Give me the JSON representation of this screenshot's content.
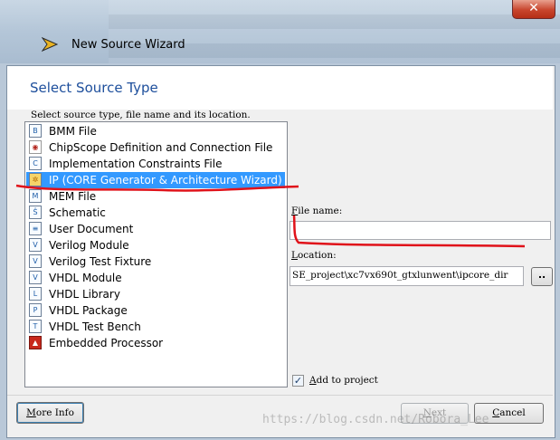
{
  "window": {
    "title": "New Source Wizard",
    "close_label": "✕"
  },
  "page": {
    "heading": "Select Source Type",
    "instruction": "Select source type, file name and its location."
  },
  "source_types": [
    {
      "label": "BMM File",
      "icon": "bmm-file-icon",
      "selected": false
    },
    {
      "label": "ChipScope Definition and Connection File",
      "icon": "chipscope-icon",
      "selected": false
    },
    {
      "label": "Implementation Constraints File",
      "icon": "constraints-file-icon",
      "selected": false
    },
    {
      "label": "IP (CORE Generator & Architecture Wizard)",
      "icon": "ip-core-icon",
      "selected": true
    },
    {
      "label": "MEM File",
      "icon": "mem-file-icon",
      "selected": false
    },
    {
      "label": "Schematic",
      "icon": "schematic-icon",
      "selected": false
    },
    {
      "label": "User Document",
      "icon": "document-icon",
      "selected": false
    },
    {
      "label": "Verilog Module",
      "icon": "verilog-module-icon",
      "selected": false
    },
    {
      "label": "Verilog Test Fixture",
      "icon": "verilog-test-icon",
      "selected": false
    },
    {
      "label": "VHDL Module",
      "icon": "vhdl-module-icon",
      "selected": false
    },
    {
      "label": "VHDL Library",
      "icon": "vhdl-library-icon",
      "selected": false
    },
    {
      "label": "VHDL Package",
      "icon": "vhdl-package-icon",
      "selected": false
    },
    {
      "label": "VHDL Test Bench",
      "icon": "vhdl-testbench-icon",
      "selected": false
    },
    {
      "label": "Embedded Processor",
      "icon": "embedded-processor-icon",
      "selected": false
    }
  ],
  "file_name": {
    "label_key": "F",
    "label_rest": "ile name:",
    "value": ""
  },
  "location": {
    "label_key": "L",
    "label_rest": "ocation:",
    "value": "SE_project\\xc7vx690t_gtxlunwent\\ipcore_dir",
    "browse_label": ".."
  },
  "add_to_project": {
    "label_key": "A",
    "label_rest": "dd to project",
    "checked": true
  },
  "buttons": {
    "more_info_key": "M",
    "more_info_rest": "ore Info",
    "next_key": "N",
    "next_rest": "ext",
    "cancel_key": "C",
    "cancel_rest": "ancel"
  },
  "watermark": "https://blog.csdn.net/Robora_Lee",
  "colors": {
    "heading": "#1e4f9c",
    "selection": "#3399ff",
    "annotation_red": "#e0121a"
  }
}
